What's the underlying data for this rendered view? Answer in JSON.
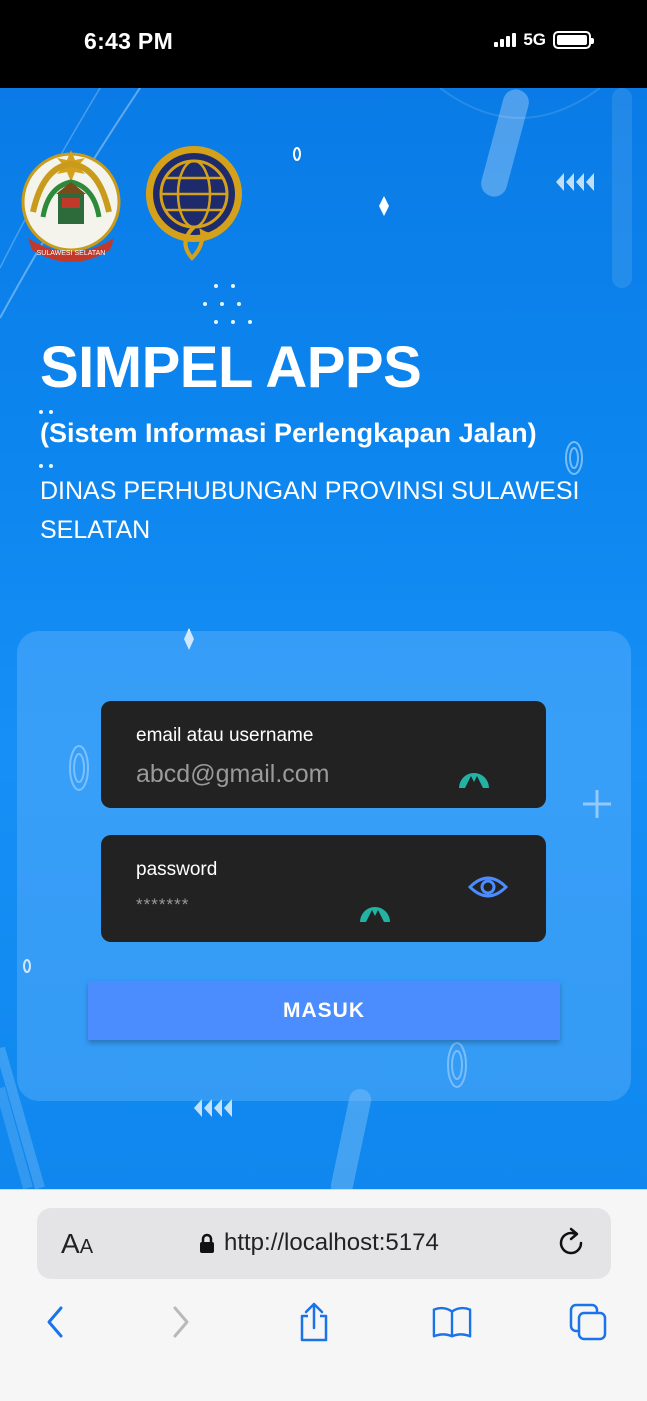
{
  "status_bar": {
    "time": "6:43 PM",
    "network": "5G"
  },
  "hero": {
    "title": "SIMPEL APPS",
    "subtitle": "(Sistem Informasi Perlengkapan Jalan)",
    "agency": "DINAS PERHUBUNGAN PROVINSI SULAWESI SELATAN"
  },
  "login": {
    "email_label": "email atau username",
    "email_placeholder": "abcd@gmail.com",
    "password_label": "password",
    "password_value": "*******",
    "submit_label": "MASUK"
  },
  "browser": {
    "url": "http://localhost:5174",
    "text_size_big": "A",
    "text_size_small": "A"
  },
  "colors": {
    "accent": "#4b8cff",
    "field_bg": "#222222",
    "hero_blue": "#0d86ef"
  }
}
